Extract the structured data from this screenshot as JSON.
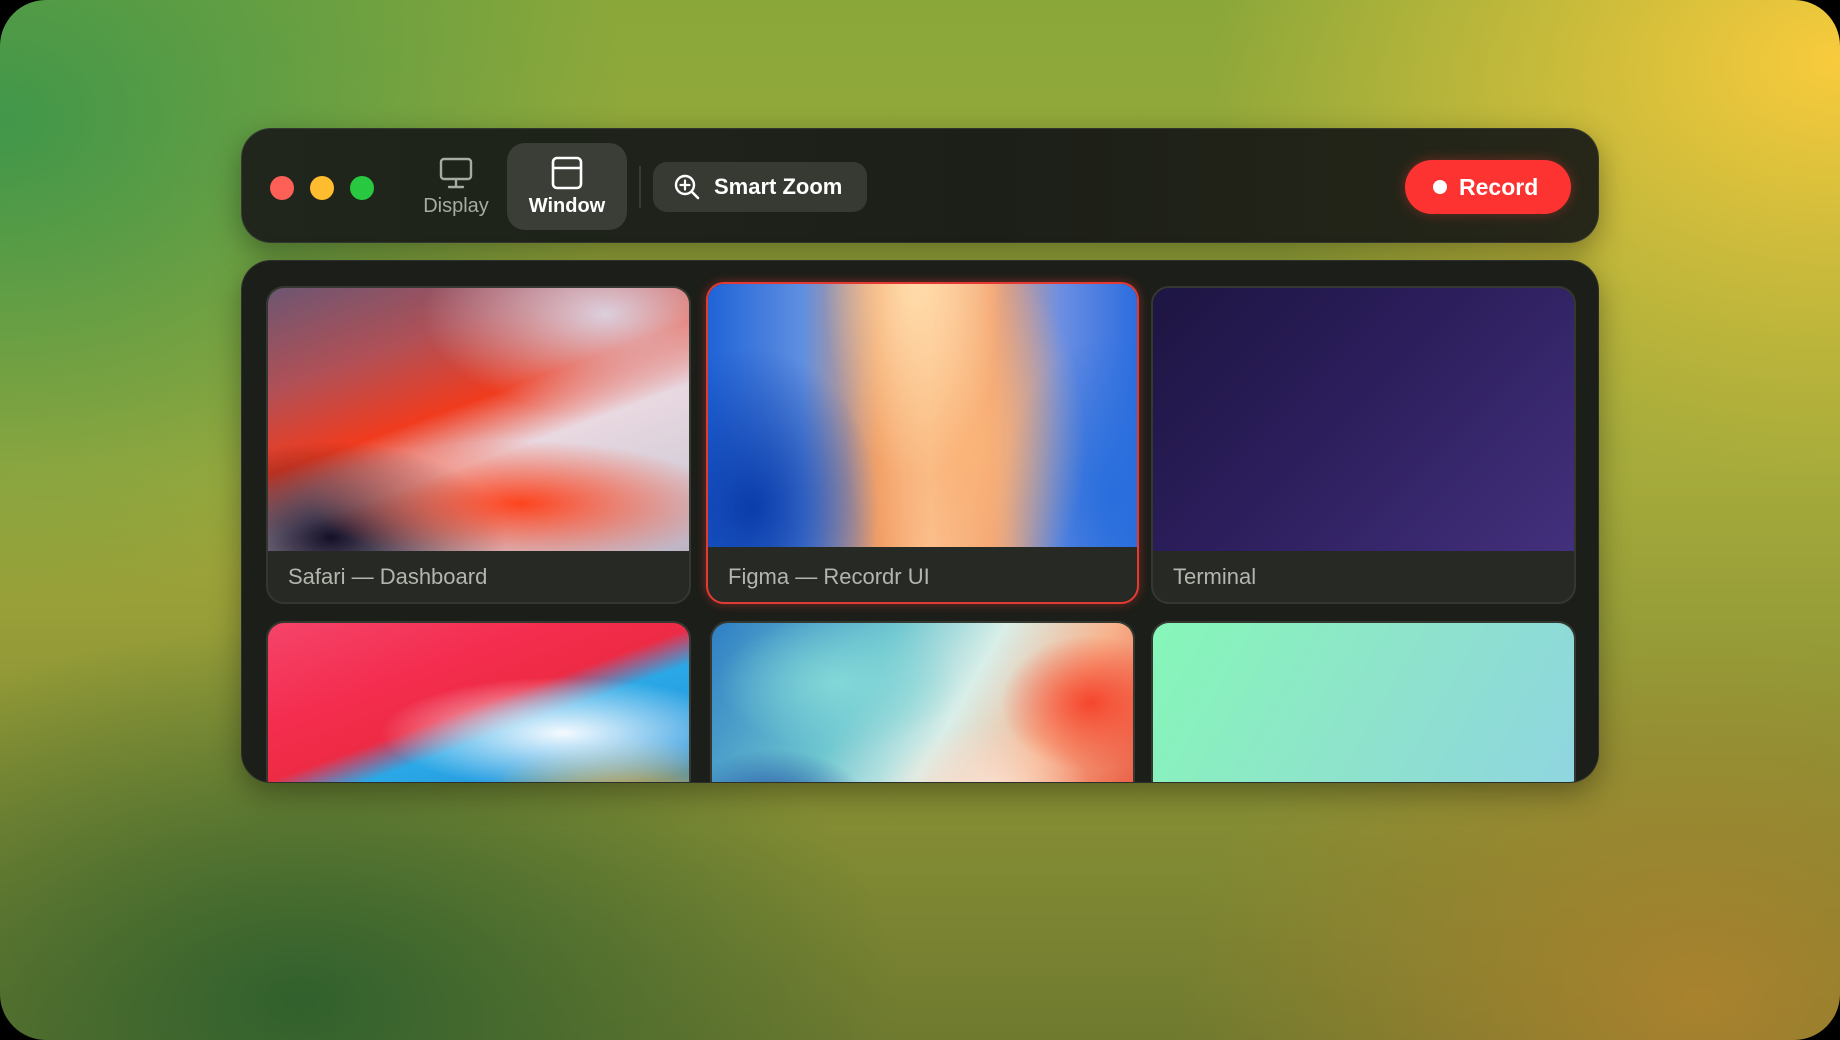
{
  "toolbar": {
    "window_controls": {
      "close_color": "#fe5f57",
      "minimize_color": "#febc2e",
      "zoom_color": "#28c840"
    },
    "source_modes": [
      {
        "label": "Display",
        "icon": "monitor-icon",
        "selected": false
      },
      {
        "label": "Window",
        "icon": "window-icon",
        "selected": true
      }
    ],
    "smart_zoom": {
      "label": "Smart Zoom",
      "icon": "zoom-in-icon"
    },
    "record": {
      "label": "Record",
      "icon": "record-dot-icon",
      "color": "#fc3330"
    }
  },
  "windows": [
    {
      "label": "Safari — Dashboard",
      "selected": false
    },
    {
      "label": "Figma — Recordr UI",
      "selected": true
    },
    {
      "label": "Terminal",
      "selected": false
    },
    {
      "label": "",
      "selected": false
    },
    {
      "label": "",
      "selected": false
    },
    {
      "label": "",
      "selected": false
    }
  ],
  "colors": {
    "accent": "#e23b33",
    "toolbar_bg": "#1f221b",
    "panel_bg": "#1c1e19"
  }
}
